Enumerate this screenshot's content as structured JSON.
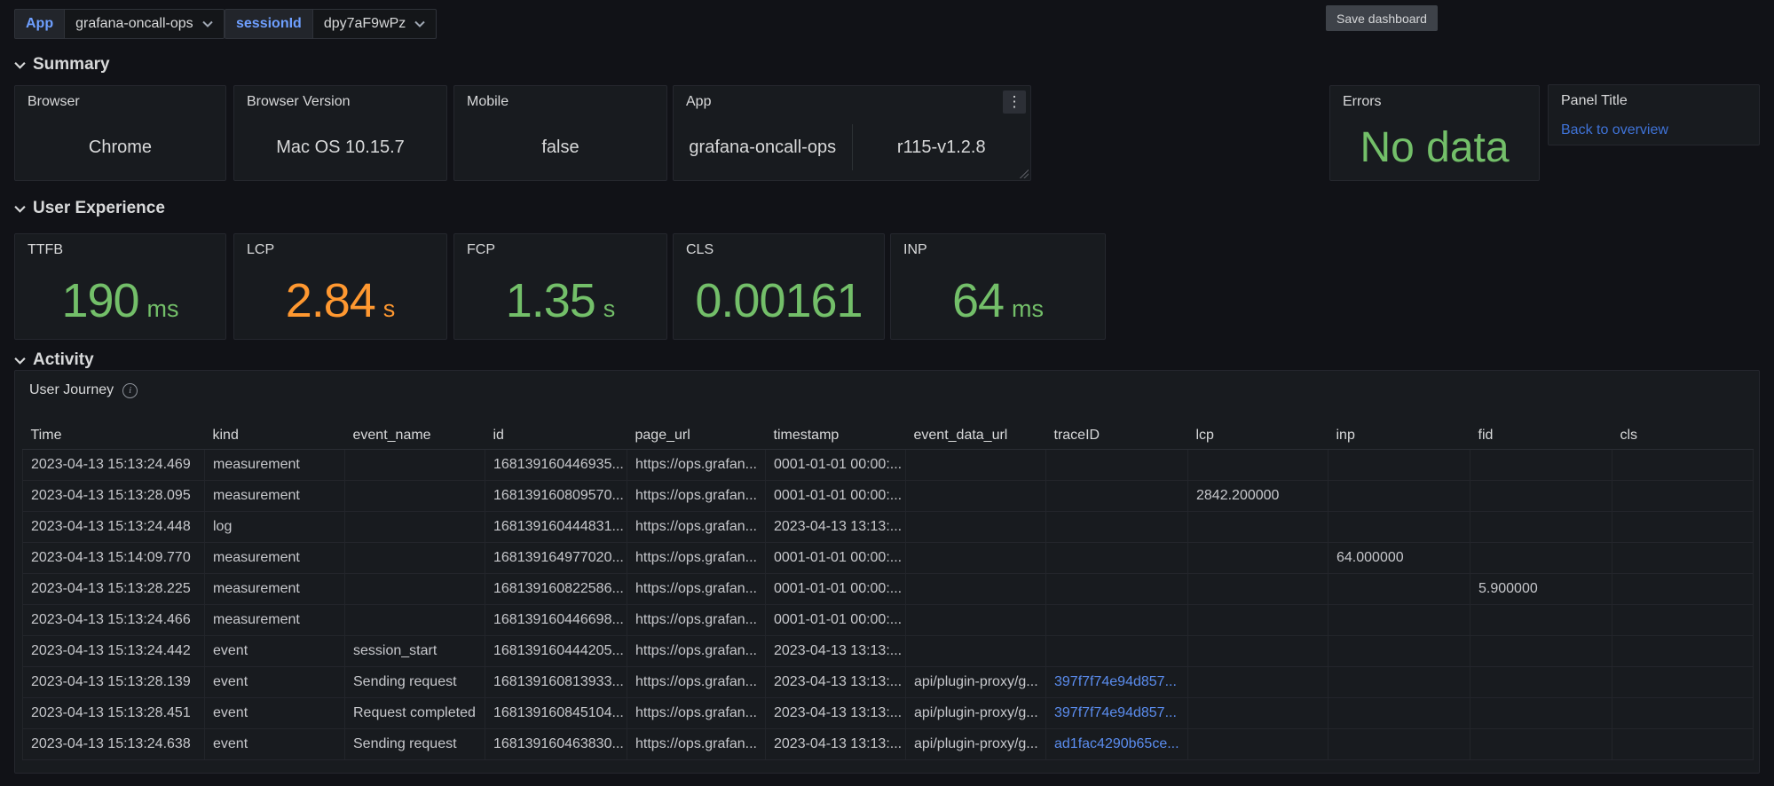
{
  "toolbar": {
    "variables": [
      {
        "label": "App",
        "value": "grafana-oncall-ops"
      },
      {
        "label": "sessionId",
        "value": "dpy7aF9wPz"
      }
    ],
    "save_button_label": "Save dashboard"
  },
  "colors": {
    "green": "#73BF69",
    "orange": "#FF9830",
    "link_blue": "#3f73d8",
    "trace_link_blue": "#5b8def",
    "variable_label_blue": "#6e9fff"
  },
  "sections": {
    "summary": {
      "title": "Summary"
    },
    "user_experience": {
      "title": "User Experience"
    },
    "activity": {
      "title": "Activity"
    }
  },
  "summary": {
    "browser": {
      "title": "Browser",
      "value": "Chrome"
    },
    "browser_version": {
      "title": "Browser Version",
      "value": "Mac OS 10.15.7"
    },
    "mobile": {
      "title": "Mobile",
      "value": "false"
    },
    "app": {
      "title": "App",
      "value_left": "grafana-oncall-ops",
      "value_right": "r115-v1.2.8",
      "menu_icon": "⋮"
    },
    "errors": {
      "title": "Errors",
      "value": "No data",
      "color": "#73BF69"
    },
    "panel_title": {
      "title": "Panel Title",
      "link": "Back to overview"
    }
  },
  "user_experience": {
    "stats": [
      {
        "title": "TTFB",
        "value": "190",
        "unit": "ms",
        "color": "#73BF69"
      },
      {
        "title": "LCP",
        "value": "2.84",
        "unit": "s",
        "color": "#FF9830"
      },
      {
        "title": "FCP",
        "value": "1.35",
        "unit": "s",
        "color": "#73BF69"
      },
      {
        "title": "CLS",
        "value": "0.00161",
        "unit": "",
        "color": "#73BF69"
      },
      {
        "title": "INP",
        "value": "64",
        "unit": "ms",
        "color": "#73BF69"
      }
    ]
  },
  "activity": {
    "panel_title": "User Journey",
    "table": {
      "columns": [
        "Time",
        "kind",
        "event_name",
        "id",
        "page_url",
        "timestamp",
        "event_data_url",
        "traceID",
        "lcp",
        "inp",
        "fid",
        "cls"
      ],
      "link_column": "traceID",
      "rows": [
        [
          "2023-04-13 15:13:24.469",
          "measurement",
          "",
          "168139160446935...",
          "https://ops.grafan...",
          "0001-01-01 00:00:...",
          "",
          "",
          "",
          "",
          "",
          ""
        ],
        [
          "2023-04-13 15:13:28.095",
          "measurement",
          "",
          "168139160809570...",
          "https://ops.grafan...",
          "0001-01-01 00:00:...",
          "",
          "",
          "2842.200000",
          "",
          "",
          ""
        ],
        [
          "2023-04-13 15:13:24.448",
          "log",
          "",
          "168139160444831...",
          "https://ops.grafan...",
          "2023-04-13 13:13:...",
          "",
          "",
          "",
          "",
          "",
          ""
        ],
        [
          "2023-04-13 15:14:09.770",
          "measurement",
          "",
          "168139164977020...",
          "https://ops.grafan...",
          "0001-01-01 00:00:...",
          "",
          "",
          "",
          "64.000000",
          "",
          ""
        ],
        [
          "2023-04-13 15:13:28.225",
          "measurement",
          "",
          "168139160822586...",
          "https://ops.grafan...",
          "0001-01-01 00:00:...",
          "",
          "",
          "",
          "",
          "5.900000",
          ""
        ],
        [
          "2023-04-13 15:13:24.466",
          "measurement",
          "",
          "168139160446698...",
          "https://ops.grafan...",
          "0001-01-01 00:00:...",
          "",
          "",
          "",
          "",
          "",
          ""
        ],
        [
          "2023-04-13 15:13:24.442",
          "event",
          "session_start",
          "168139160444205...",
          "https://ops.grafan...",
          "2023-04-13 13:13:...",
          "",
          "",
          "",
          "",
          "",
          ""
        ],
        [
          "2023-04-13 15:13:28.139",
          "event",
          "Sending request",
          "168139160813933...",
          "https://ops.grafan...",
          "2023-04-13 13:13:...",
          "api/plugin-proxy/g...",
          "397f7f74e94d857...",
          "",
          "",
          "",
          ""
        ],
        [
          "2023-04-13 15:13:28.451",
          "event",
          "Request completed",
          "168139160845104...",
          "https://ops.grafan...",
          "2023-04-13 13:13:...",
          "api/plugin-proxy/g...",
          "397f7f74e94d857...",
          "",
          "",
          "",
          ""
        ],
        [
          "2023-04-13 15:13:24.638",
          "event",
          "Sending request",
          "168139160463830...",
          "https://ops.grafan...",
          "2023-04-13 13:13:...",
          "api/plugin-proxy/g...",
          "ad1fac4290b65ce...",
          "",
          "",
          "",
          ""
        ]
      ]
    }
  }
}
